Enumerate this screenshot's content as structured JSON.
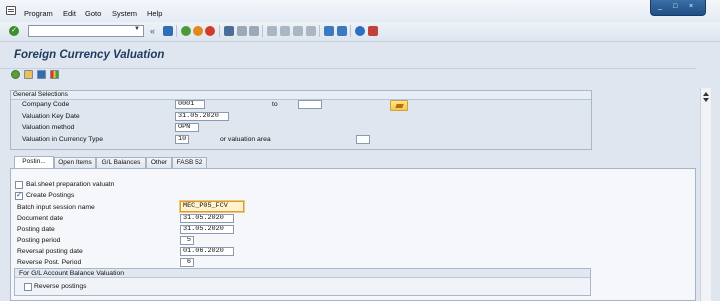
{
  "menu": {
    "items": [
      "Program",
      "Edit",
      "Goto",
      "System",
      "Help"
    ]
  },
  "window_controls": {
    "minimize": "_",
    "restore": "□",
    "close": "×"
  },
  "toolbar": {
    "command_field_value": "",
    "back_glyph": "«"
  },
  "page": {
    "title": "Foreign Currency Valuation"
  },
  "general_selections": {
    "title": "General Selections",
    "company_code_label": "Company Code",
    "company_code_value": "0001",
    "to_label": "to",
    "to_value": "",
    "valuation_key_date_label": "Valuation Key Date",
    "valuation_key_date_value": "31.05.2020",
    "valuation_method_label": "Valuation method",
    "valuation_method_value": "OPN",
    "valuation_currency_type_label": "Valuation in Currency Type",
    "valuation_currency_type_value": "10",
    "valuation_area_label": "or valuation area",
    "valuation_area_value": ""
  },
  "tabs": [
    {
      "label": "Postin...",
      "active": true
    },
    {
      "label": "Open Items",
      "active": false
    },
    {
      "label": "G/L Balances",
      "active": false
    },
    {
      "label": "Other",
      "active": false
    },
    {
      "label": "FASB 52",
      "active": false
    }
  ],
  "postings": {
    "bal_sheet_label": "Bal.sheet preparation valuatn",
    "bal_sheet_checked": false,
    "create_postings_label": "Create Postings",
    "create_postings_checked": true,
    "batch_session_label": "Batch input session name",
    "batch_session_value": "MEC_P05_FCV",
    "document_date_label": "Document date",
    "document_date_value": "31.05.2020",
    "posting_date_label": "Posting date",
    "posting_date_value": "31.05.2020",
    "posting_period_label": "Posting period",
    "posting_period_value": "5",
    "reversal_date_label": "Reversal posting date",
    "reversal_date_value": "01.06.2020",
    "reverse_period_label": "Reverse Post. Period",
    "reverse_period_value": "6",
    "gl_group_title": "For G/L Account Balance Valuation",
    "reverse_postings_label": "Reverse postings",
    "reverse_postings_checked": false,
    "check_mark": "✓"
  },
  "colors": {
    "title": "#1d3a5f",
    "background": "#dfe6ef",
    "panel": "#f5f7fa",
    "required_field": "#fff2cc"
  }
}
